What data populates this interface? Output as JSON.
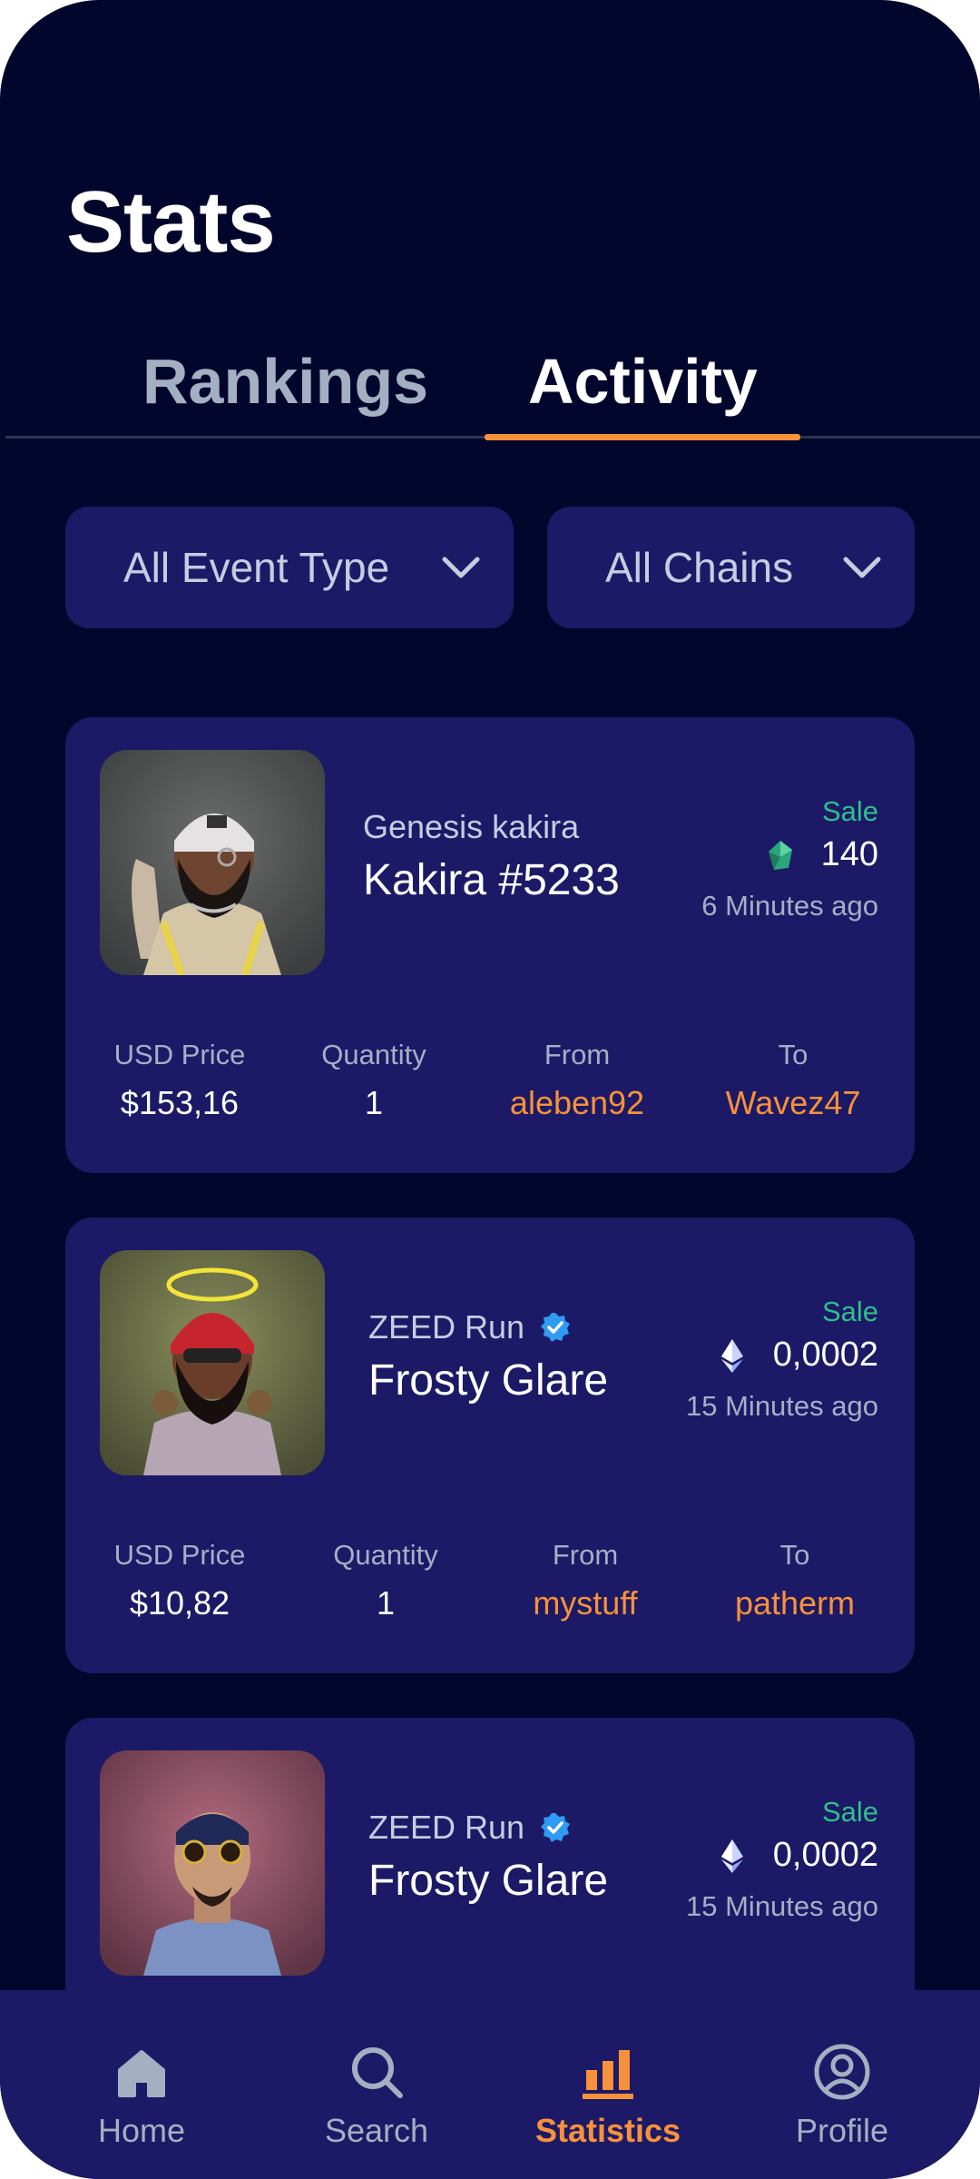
{
  "header": {
    "title": "Stats"
  },
  "tabs": [
    {
      "label": "Rankings",
      "active": false
    },
    {
      "label": "Activity",
      "active": true
    }
  ],
  "filters": {
    "event_type": {
      "label": "All Event Type",
      "icon": "chevron-down-icon"
    },
    "chains": {
      "label": "All Chains",
      "icon": "chevron-down-icon"
    }
  },
  "activities": [
    {
      "collection": "Genesis kakira",
      "verified": false,
      "name": "Kakira #5233",
      "event": "Sale",
      "chain_icon": "kakira-token-icon",
      "price": "140",
      "time": "6 Minutes ago",
      "stats": [
        {
          "label": "USD Price",
          "value": "$153,16"
        },
        {
          "label": "Quantity",
          "value": "1"
        },
        {
          "label": "From",
          "value": "aleben92"
        },
        {
          "label": "To",
          "value": "Wavez47"
        }
      ]
    },
    {
      "collection": "ZEED Run",
      "verified": true,
      "name": "Frosty Glare",
      "event": "Sale",
      "chain_icon": "ethereum-icon",
      "price": "0,0002",
      "time": "15 Minutes ago",
      "stats": [
        {
          "label": "USD Price",
          "value": "$10,82"
        },
        {
          "label": "Quantity",
          "value": "1"
        },
        {
          "label": "From",
          "value": "mystuff"
        },
        {
          "label": "To",
          "value": "patherm"
        }
      ]
    },
    {
      "collection": "ZEED Run",
      "verified": true,
      "name": "Frosty Glare",
      "event": "Sale",
      "chain_icon": "ethereum-icon",
      "price": "0,0002",
      "time": "15 Minutes ago"
    }
  ],
  "nav": [
    {
      "label": "Home",
      "icon": "home-icon",
      "active": false
    },
    {
      "label": "Search",
      "icon": "search-icon",
      "active": false
    },
    {
      "label": "Statistics",
      "icon": "bar-chart-icon",
      "active": true
    },
    {
      "label": "Profile",
      "icon": "profile-icon",
      "active": false
    }
  ],
  "colors": {
    "background": "#03062c",
    "card": "#1c1a66",
    "accent": "#f7913a",
    "sale": "#2fbf8c",
    "muted": "#a3b0c2"
  }
}
